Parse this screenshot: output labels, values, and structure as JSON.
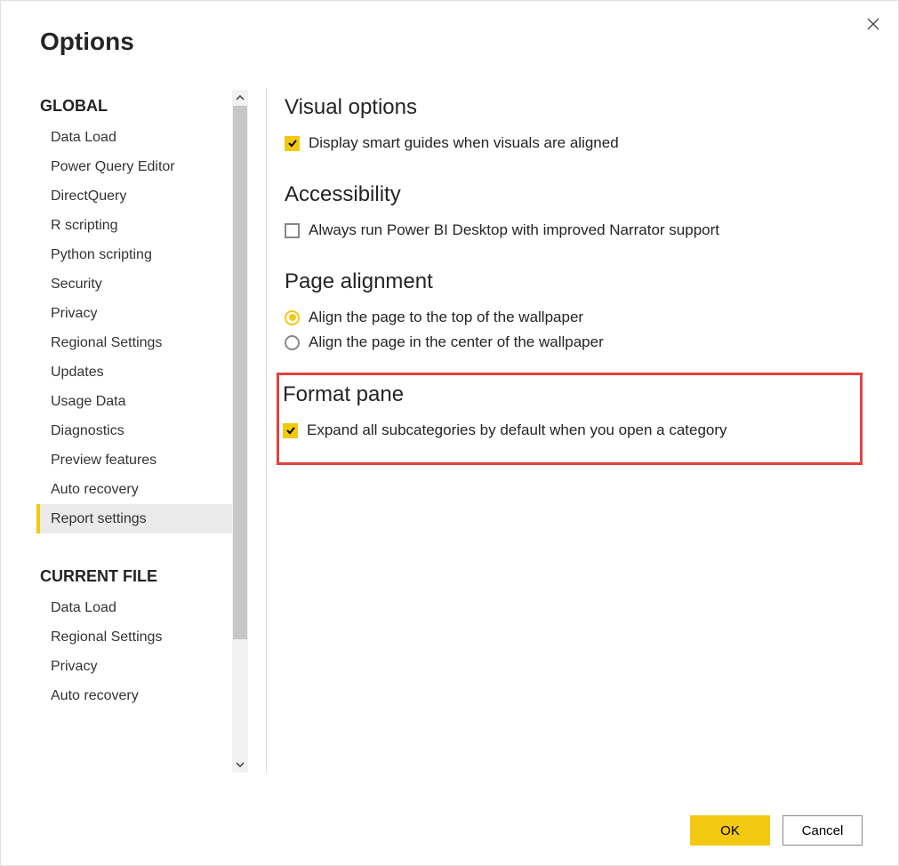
{
  "dialog": {
    "title": "Options"
  },
  "close": {
    "label": "Close"
  },
  "sidebar": {
    "sections": [
      {
        "header": "GLOBAL",
        "items": [
          {
            "label": "Data Load",
            "selected": false
          },
          {
            "label": "Power Query Editor",
            "selected": false
          },
          {
            "label": "DirectQuery",
            "selected": false
          },
          {
            "label": "R scripting",
            "selected": false
          },
          {
            "label": "Python scripting",
            "selected": false
          },
          {
            "label": "Security",
            "selected": false
          },
          {
            "label": "Privacy",
            "selected": false
          },
          {
            "label": "Regional Settings",
            "selected": false
          },
          {
            "label": "Updates",
            "selected": false
          },
          {
            "label": "Usage Data",
            "selected": false
          },
          {
            "label": "Diagnostics",
            "selected": false
          },
          {
            "label": "Preview features",
            "selected": false
          },
          {
            "label": "Auto recovery",
            "selected": false
          },
          {
            "label": "Report settings",
            "selected": true
          }
        ]
      },
      {
        "header": "CURRENT FILE",
        "items": [
          {
            "label": "Data Load",
            "selected": false
          },
          {
            "label": "Regional Settings",
            "selected": false
          },
          {
            "label": "Privacy",
            "selected": false
          },
          {
            "label": "Auto recovery",
            "selected": false
          }
        ]
      }
    ]
  },
  "content": {
    "groups": [
      {
        "title": "Visual options",
        "highlighted": false,
        "options": [
          {
            "type": "checkbox",
            "checked": true,
            "label": "Display smart guides when visuals are aligned"
          }
        ]
      },
      {
        "title": "Accessibility",
        "highlighted": false,
        "options": [
          {
            "type": "checkbox",
            "checked": false,
            "label": "Always run Power BI Desktop with improved Narrator support"
          }
        ]
      },
      {
        "title": "Page alignment",
        "highlighted": false,
        "options": [
          {
            "type": "radio",
            "checked": true,
            "label": "Align the page to the top of the wallpaper"
          },
          {
            "type": "radio",
            "checked": false,
            "label": "Align the page in the center of the wallpaper"
          }
        ]
      },
      {
        "title": "Format pane",
        "highlighted": true,
        "options": [
          {
            "type": "checkbox",
            "checked": true,
            "label": "Expand all subcategories by default when you open a category"
          }
        ]
      }
    ]
  },
  "footer": {
    "ok": "OK",
    "cancel": "Cancel"
  }
}
